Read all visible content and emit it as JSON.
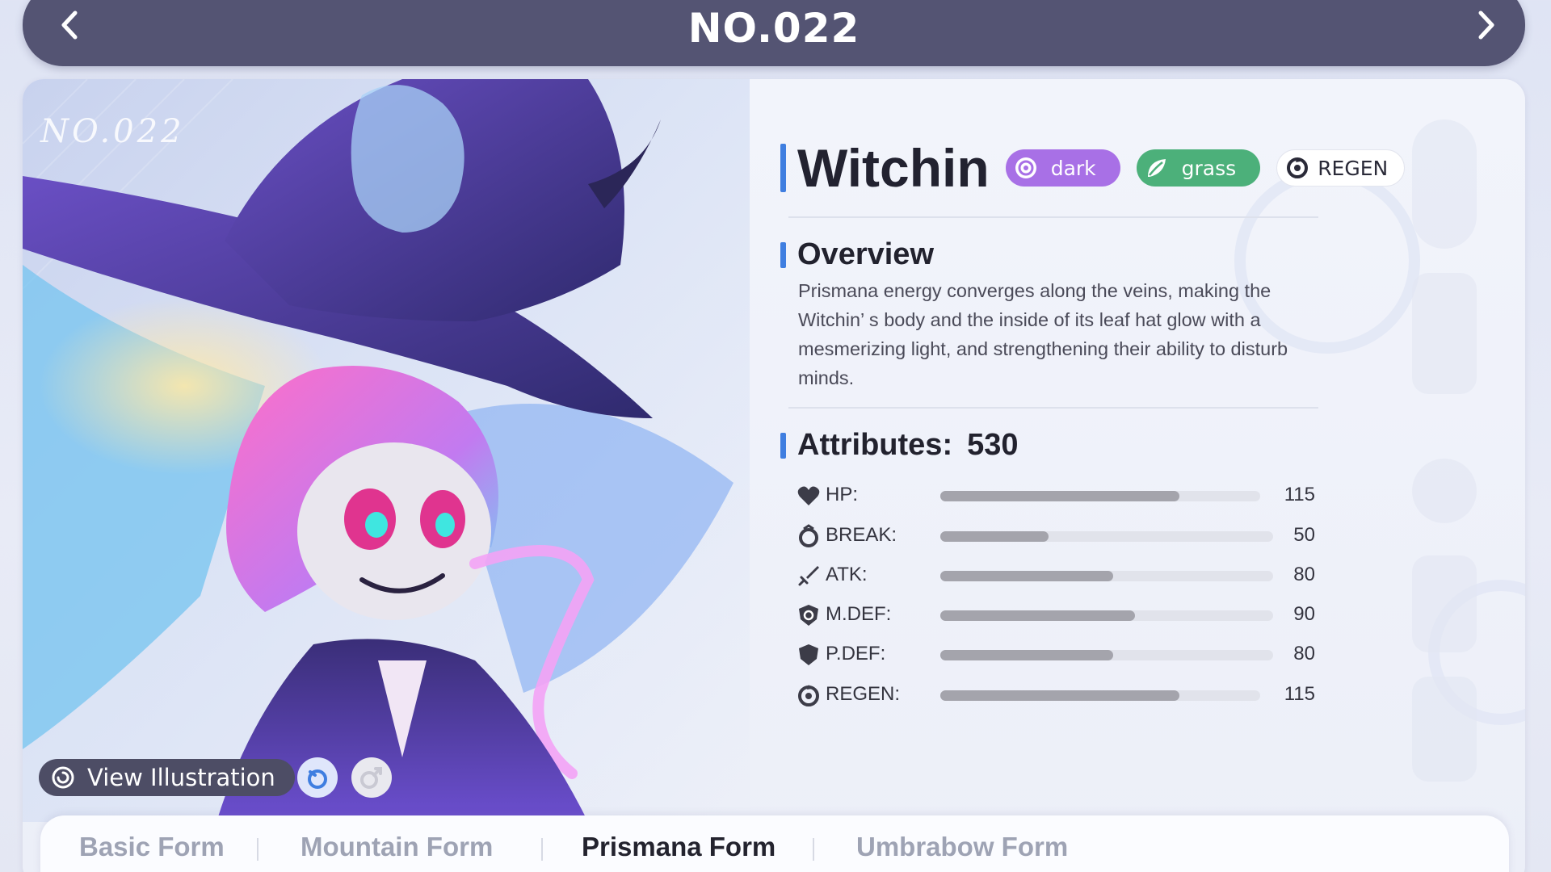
{
  "header": {
    "title": "NO.022",
    "prev_icon": "chevron-left-icon",
    "next_icon": "chevron-right-icon"
  },
  "illustration": {
    "number_text": "NO.022",
    "view_button_label": "View Illustration",
    "view_icon": "spiral-icon",
    "female_icon": "female-icon",
    "male_icon": "male-icon"
  },
  "creature": {
    "name": "Witchin",
    "types": [
      {
        "label": "dark",
        "icon": "dark-type-icon",
        "color": "#a870e6"
      },
      {
        "label": "grass",
        "icon": "grass-leaf-icon",
        "color": "#4cb07a"
      }
    ],
    "trait": {
      "label": "REGEN",
      "icon": "regen-icon"
    }
  },
  "overview": {
    "heading": "Overview",
    "text": "Prismana energy converges along the veins, making the Witchin’ s body and the inside of its leaf hat glow with a mesmerizing light, and strengthening their ability to disturb minds."
  },
  "attributes": {
    "heading": "Attributes:",
    "total": "530",
    "max": 200,
    "stats": [
      {
        "label": "HP:",
        "value": 115,
        "icon": "heart-icon"
      },
      {
        "label": "BREAK:",
        "value": 50,
        "icon": "break-icon"
      },
      {
        "label": "ATK:",
        "value": 80,
        "icon": "sword-icon"
      },
      {
        "label": "M.DEF:",
        "value": 90,
        "icon": "magic-shield-icon"
      },
      {
        "label": "P.DEF:",
        "value": 80,
        "icon": "shield-icon"
      },
      {
        "label": "REGEN:",
        "value": 115,
        "icon": "regen-icon"
      }
    ]
  },
  "forms": {
    "tabs": [
      {
        "label": "Basic Form",
        "active": false
      },
      {
        "label": "Mountain Form",
        "active": false
      },
      {
        "label": "Prismana Form",
        "active": true
      },
      {
        "label": "Umbrabow Form",
        "active": false
      }
    ]
  },
  "colors": {
    "header_bg": "#545473",
    "accent_blue": "#3f7ee0",
    "bar_fill": "#a4a4ac"
  }
}
